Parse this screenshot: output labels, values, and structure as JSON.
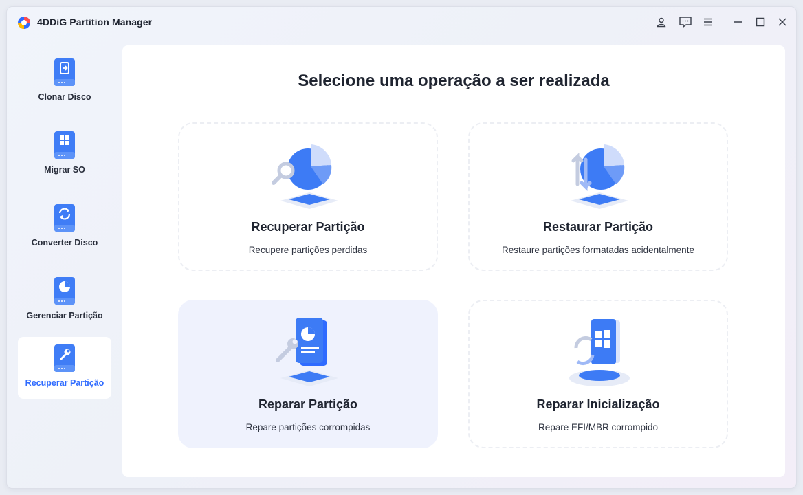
{
  "window": {
    "title": "4DDiG Partition Manager"
  },
  "titlebar": {
    "icons": [
      "account-icon",
      "feedback-icon",
      "menu-icon",
      "minimize-icon",
      "maximize-icon",
      "close-icon"
    ]
  },
  "sidebar": {
    "items": [
      {
        "label": "Clonar Disco",
        "icon": "clone-disk-icon",
        "active": false
      },
      {
        "label": "Migrar SO",
        "icon": "migrate-os-icon",
        "active": false
      },
      {
        "label": "Converter Disco",
        "icon": "convert-disk-icon",
        "active": false
      },
      {
        "label": "Gerenciar Partição",
        "icon": "manage-partition-icon",
        "active": false
      },
      {
        "label": "Recuperar Partição",
        "icon": "recover-partition-icon",
        "active": true
      }
    ]
  },
  "main": {
    "title": "Selecione uma operação a ser realizada",
    "cards": [
      {
        "title": "Recuperar Partição",
        "desc": "Recupere partições perdidas",
        "icon": "partition-search-icon"
      },
      {
        "title": "Restaurar Partição",
        "desc": "Restaure partições formatadas acidentalmente",
        "icon": "partition-restore-icon"
      },
      {
        "title": "Reparar Partição",
        "desc": "Repare partições corrompidas",
        "icon": "partition-repair-icon"
      },
      {
        "title": "Reparar Inicialização",
        "desc": "Repare EFI/MBR corrompido",
        "icon": "boot-repair-icon"
      }
    ]
  },
  "colors": {
    "accent": "#2f6bff",
    "text": "#1f2430",
    "card_hover": "#eff2fd",
    "icon_blue": "#3d7bf5"
  }
}
